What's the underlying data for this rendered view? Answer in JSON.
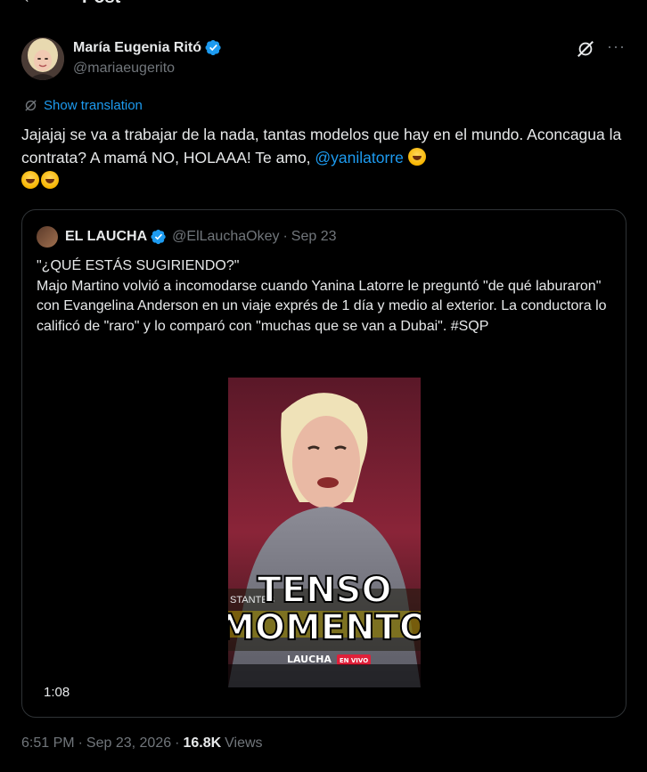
{
  "topbar": {
    "back_glyph": "←",
    "title": "Post"
  },
  "post": {
    "author": {
      "display_name": "María Eugenia Ritó",
      "handle": "@mariaeugerito",
      "verified": true
    },
    "translate_label": "Show translation",
    "text_part1": "Jajajaj se va a trabajar de la nada, tantas modelos que hay en el mundo. Aconcagua la contrata? A mamá NO, HOLAAA! Te amo, ",
    "mention": "@yanilatorre",
    "emojis": [
      "rolling-on-floor-laughing",
      "rolling-on-floor-laughing",
      "rolling-on-floor-laughing"
    ]
  },
  "quote": {
    "author": {
      "display_name": "EL LAUCHA",
      "handle": "@ElLauchaOkey",
      "verified": true
    },
    "separator": "·",
    "date": "Sep 23",
    "text_line1": "\"¿QUÉ ESTÁS SUGIRIENDO?\"",
    "text_body": "Majo Martino volvió a incomodarse cuando Yanina Latorre le preguntó \"de qué laburaron\" con Evangelina Anderson en un viaje exprés de 1 día y medio al exterior. La conductora lo calificó de \"raro\" y lo comparó con \"muchas que se van a Dubai\". #SQP",
    "video": {
      "overlay_line1": "TENSO",
      "overlay_line2": "MOMENTO",
      "brand": "LAUCHA",
      "live_badge": "EN VIVO",
      "ticker_left": "STANTES",
      "duration": "1:08"
    }
  },
  "footer": {
    "time": "6:51 PM",
    "separator": "·",
    "date": "Sep 23, 2026",
    "separator2": "·",
    "views_count": "16.8K",
    "views_label": "Views"
  },
  "colors": {
    "accent": "#1d9bf0",
    "muted": "#71767b",
    "text": "#e7e9ea",
    "border": "#2f3336"
  }
}
